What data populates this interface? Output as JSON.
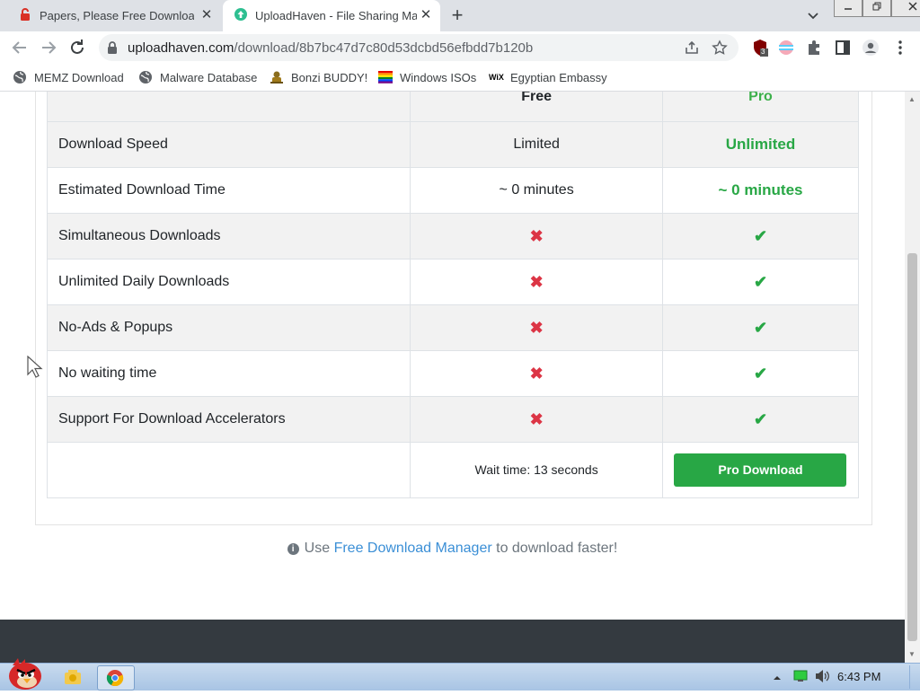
{
  "browser": {
    "tabs": [
      {
        "title": "Papers, Please Free Download",
        "active": false
      },
      {
        "title": "UploadHaven - File Sharing Made Simple",
        "active": true
      }
    ],
    "new_tab_symbol": "+",
    "close_symbol": "✕",
    "url_domain": "uploadhaven.com",
    "url_path": "/download/8b7bc47d7c80d53dcbd56efbdd7b120b",
    "extension_badge": "3",
    "bookmarks": [
      "MEMZ Download",
      "Malware Database",
      "Bonzi BUDDY!",
      "Windows ISOs",
      "Egyptian Embassy"
    ],
    "wix_label": "WiX"
  },
  "page": {
    "headers": {
      "free": "Free",
      "pro": "Pro"
    },
    "rows": [
      {
        "feature": "Download Speed",
        "free": "Limited",
        "pro": "Unlimited"
      },
      {
        "feature": "Estimated Download Time",
        "free": "~ 0 minutes",
        "pro": "~ 0 minutes"
      },
      {
        "feature": "Simultaneous Downloads",
        "free": "✖",
        "pro": "✔"
      },
      {
        "feature": "Unlimited Daily Downloads",
        "free": "✖",
        "pro": "✔"
      },
      {
        "feature": "No-Ads & Popups",
        "free": "✖",
        "pro": "✔"
      },
      {
        "feature": "No waiting time",
        "free": "✖",
        "pro": "✔"
      },
      {
        "feature": "Support For Download Accelerators",
        "free": "✖",
        "pro": "✔"
      }
    ],
    "wait_text": "Wait time: 13 seconds",
    "pro_button": "Pro Download",
    "tip_prefix": "Use ",
    "tip_link": "Free Download Manager",
    "tip_suffix": " to download faster!",
    "info_symbol": "i"
  },
  "taskbar": {
    "clock": "6:43 PM"
  },
  "colors": {
    "accent_green": "#28a745",
    "cross_red": "#dc3545",
    "link_blue": "#3b8fd6",
    "footer": "#343a40"
  }
}
